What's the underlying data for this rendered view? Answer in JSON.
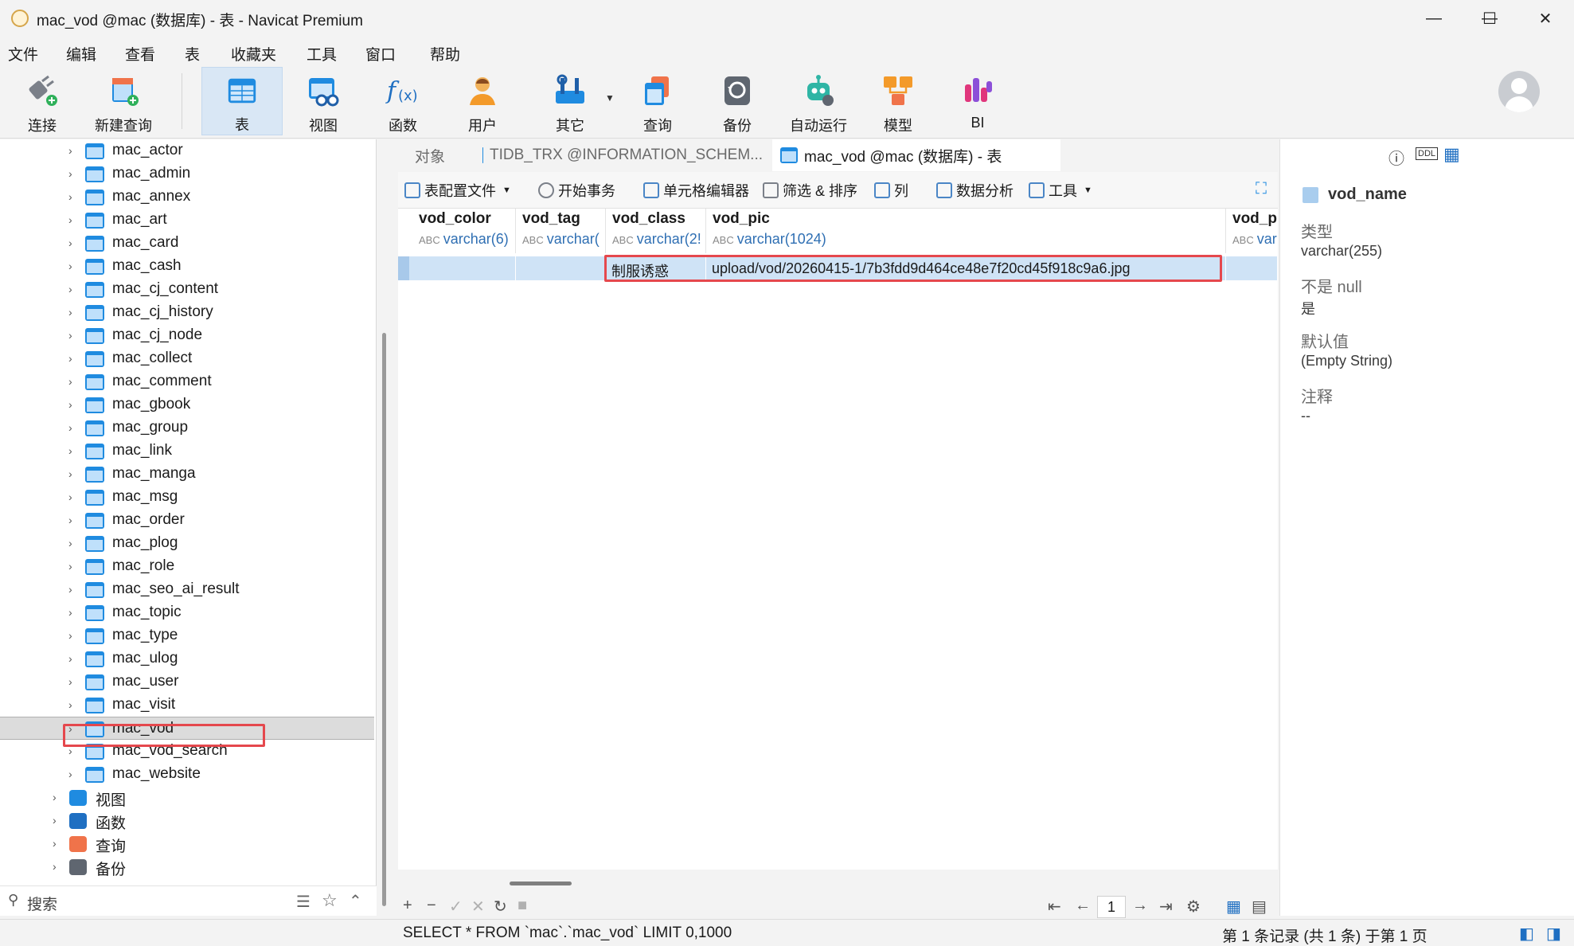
{
  "window": {
    "title": "mac_vod @mac (数据库) - 表 - Navicat Premium",
    "minimize": "—",
    "maximize": "☐",
    "close": "✕"
  },
  "menu": [
    "文件",
    "编辑",
    "查看",
    "表",
    "收藏夹",
    "工具",
    "窗口",
    "帮助"
  ],
  "toolbar": {
    "connect": "连接",
    "new_query": "新建查询",
    "table": "表",
    "view": "视图",
    "function": "函数",
    "user": "用户",
    "other": "其它",
    "query": "查询",
    "backup": "备份",
    "automation": "自动运行",
    "model": "模型",
    "bi": "BI"
  },
  "navigator": {
    "tables": [
      "mac_actor",
      "mac_admin",
      "mac_annex",
      "mac_art",
      "mac_card",
      "mac_cash",
      "mac_cj_content",
      "mac_cj_history",
      "mac_cj_node",
      "mac_collect",
      "mac_comment",
      "mac_gbook",
      "mac_group",
      "mac_link",
      "mac_manga",
      "mac_msg",
      "mac_order",
      "mac_plog",
      "mac_role",
      "mac_seo_ai_result",
      "mac_topic",
      "mac_type",
      "mac_ulog",
      "mac_user",
      "mac_visit",
      "mac_vod",
      "mac_vod_search",
      "mac_website"
    ],
    "selected": "mac_vod",
    "groups": [
      "视图",
      "函数",
      "查询",
      "备份"
    ],
    "search_placeholder": "搜索"
  },
  "tabs": {
    "objects": "对象",
    "tidb": "TIDB_TRX @INFORMATION_SCHEM...",
    "active": "mac_vod @mac (数据库) - 表"
  },
  "object_toolbar": {
    "profile": "表配置文件",
    "begin_tx": "开始事务",
    "cell_editor": "单元格编辑器",
    "filter_sort": "筛选 & 排序",
    "columns": "列",
    "data_analysis": "数据分析",
    "tools": "工具"
  },
  "grid": {
    "columns": [
      {
        "name": "vod_color",
        "type": "varchar(6)"
      },
      {
        "name": "vod_tag",
        "type": "varchar("
      },
      {
        "name": "vod_class",
        "type": "varchar(2!"
      },
      {
        "name": "vod_pic",
        "type": "varchar(1024)"
      },
      {
        "name": "vod_p",
        "type": "var"
      }
    ],
    "row": {
      "vod_color": "",
      "vod_tag": "",
      "vod_class": "制服诱惑",
      "vod_pic": "upload/vod/20260415-1/7b3fdd9d464ce48e7f20cd45f918c9a6.jpg",
      "vod_p": ""
    },
    "page": "1"
  },
  "field_panel": {
    "name": "vod_name",
    "type_label": "类型",
    "type_value": "varchar(255)",
    "notnull_label": "不是 null",
    "notnull_value": "是",
    "default_label": "默认值",
    "default_value": "(Empty String)",
    "comment_label": "注释",
    "comment_value": "--"
  },
  "status": {
    "sql": "SELECT * FROM `mac`.`mac_vod` LIMIT 0,1000",
    "records": "第 1 条记录 (共 1 条) 于第 1 页"
  },
  "colors": {
    "selection_row": "#cfe3f6",
    "highlight": "#e5484d",
    "accent": "#1f8be0"
  }
}
